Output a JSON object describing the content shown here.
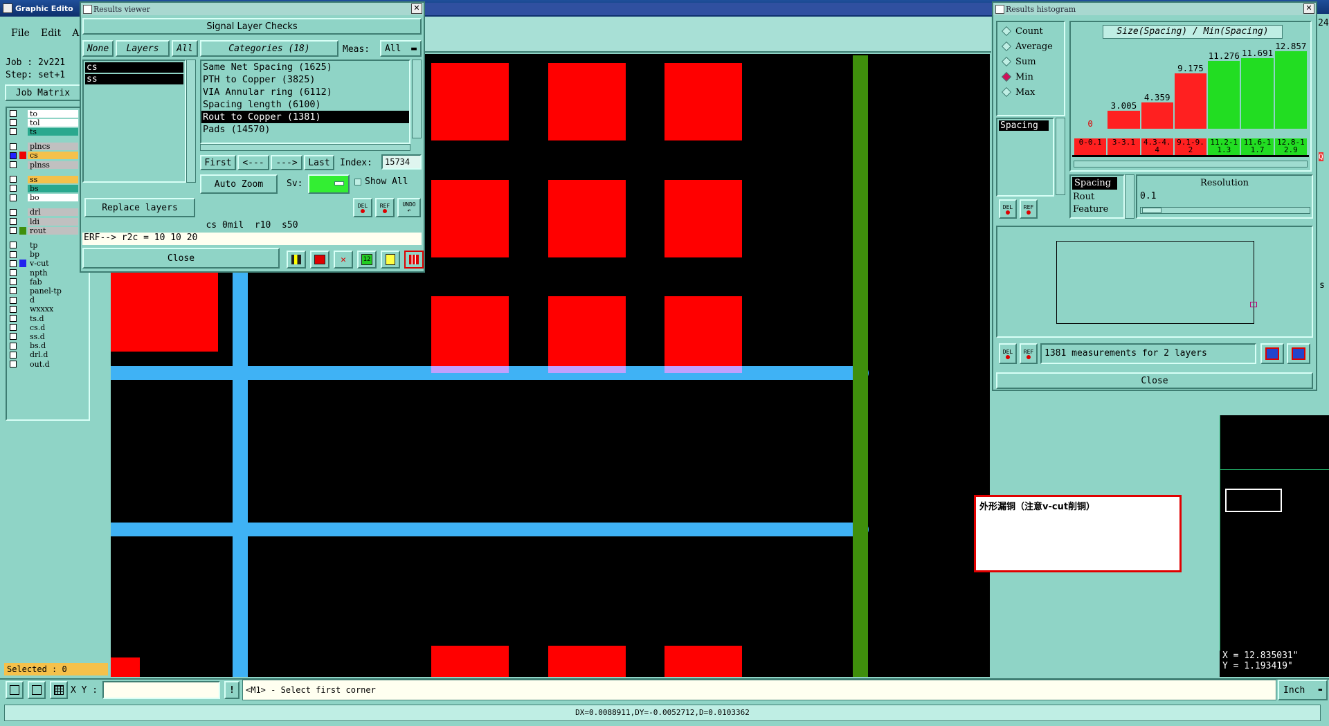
{
  "main_window": {
    "title": "Graphic Edito",
    "menu": [
      "File",
      "Edit",
      "A"
    ],
    "job_label": "Job : 2v221",
    "step_label": "Step: set+1",
    "job_matrix_label": "Job Matrix",
    "selected_label": "Selected : 0"
  },
  "layers": [
    {
      "name": "to",
      "color": "#ffffff"
    },
    {
      "name": "tol",
      "color": "#ffffff"
    },
    {
      "name": "ts",
      "color": "#2aa88e"
    },
    {
      "name": "plncs",
      "color": "#c0c0c0"
    },
    {
      "name": "cs",
      "color": "#f5c14b",
      "active": true
    },
    {
      "name": "plnss",
      "color": "#c0c0c0"
    },
    {
      "name": "ss",
      "color": "#f5c14b"
    },
    {
      "name": "bs",
      "color": "#2aa88e"
    },
    {
      "name": "bo",
      "color": "#ffffff"
    },
    {
      "name": "drl",
      "color": "#c0c0c0"
    },
    {
      "name": "ldi",
      "color": "#c0c0c0"
    },
    {
      "name": "rout",
      "color": "#c0c0c0"
    },
    {
      "name": "tp",
      "color": "#8fd4c6"
    },
    {
      "name": "bp",
      "color": "#8fd4c6"
    },
    {
      "name": "v-cut",
      "color": "#8fd4c6"
    },
    {
      "name": "npth",
      "color": "#8fd4c6"
    },
    {
      "name": "fab",
      "color": "#8fd4c6"
    },
    {
      "name": "panel-tp",
      "color": "#8fd4c6"
    },
    {
      "name": "d",
      "color": "#8fd4c6"
    },
    {
      "name": "wxxxx",
      "color": "#8fd4c6"
    },
    {
      "name": "ts.d",
      "color": "#8fd4c6"
    },
    {
      "name": "cs.d",
      "color": "#8fd4c6"
    },
    {
      "name": "ss.d",
      "color": "#8fd4c6"
    },
    {
      "name": "bs.d",
      "color": "#8fd4c6"
    },
    {
      "name": "drl.d",
      "color": "#8fd4c6"
    },
    {
      "name": "out.d",
      "color": "#8fd4c6"
    }
  ],
  "results_viewer": {
    "title": "Results viewer",
    "header": "Signal Layer Checks",
    "none_label": "None",
    "layers_label": "Layers",
    "all_label": "All",
    "categories_label": "Categories (18)",
    "meas_label": "Meas:",
    "meas_value": "All",
    "layer_list": [
      "cs",
      "ss"
    ],
    "categories": [
      {
        "text": "Same Net Spacing (1625)"
      },
      {
        "text": "PTH to Copper (3825)"
      },
      {
        "text": "VIA Annular ring (6112)"
      },
      {
        "text": "Spacing length (6100)"
      },
      {
        "text": "Rout to Copper (1381)",
        "selected": true
      },
      {
        "text": "Pads (14570)"
      }
    ],
    "first_label": "First",
    "prev_label": "<---",
    "next_label": "--->",
    "last_label": "Last",
    "index_label": "Index:",
    "index_value": "15734",
    "auto_zoom_label": "Auto Zoom",
    "sv_label": "Sv:",
    "show_all_label": "Show All",
    "replace_layers_label": "Replace layers",
    "del_label": "DEL",
    "ref_label": "REF",
    "undo_label": "UNDO",
    "info_line": "cs 0mil  r10  s50",
    "erf_line": "ERF--> r2c = 10 10 20",
    "close_label": "Close"
  },
  "histogram": {
    "title": "Results histogram",
    "radio_options": [
      {
        "label": "Count",
        "selected": false
      },
      {
        "label": "Average",
        "selected": false
      },
      {
        "label": "Sum",
        "selected": false
      },
      {
        "label": "Min",
        "selected": true
      },
      {
        "label": "Max",
        "selected": false
      }
    ],
    "list_item": "Spacing",
    "chart_title": "Size(Spacing) / Min(Spacing)",
    "bins": [
      {
        "range": "0-0.1",
        "value": 0,
        "label": "0",
        "color": "#ff2020"
      },
      {
        "range": "3-3.1",
        "value": 3.005,
        "label": "3.005",
        "color": "#ff2020"
      },
      {
        "range": "4.3-4.4",
        "value": 4.359,
        "label": "4.359",
        "color": "#ff2020"
      },
      {
        "range": "9.1-9.2",
        "value": 9.175,
        "label": "9.175",
        "color": "#ff2020"
      },
      {
        "range": "11.2-11.3",
        "value": 11.276,
        "label": "11.276",
        "color": "#22dd22"
      },
      {
        "range": "11.6-11.7",
        "value": 11.691,
        "label": "11.691",
        "color": "#22dd22"
      },
      {
        "range": "12.8-12.9",
        "value": 12.857,
        "label": "12.857",
        "color": "#22dd22"
      }
    ],
    "attr_list": [
      "Spacing",
      "Rout",
      "Feature"
    ],
    "resolution_label": "Resolution",
    "resolution_value": "0.1",
    "status": "1381 measurements for 2 layers",
    "del_label": "DEL",
    "ref_label": "REF",
    "close_label": "Close"
  },
  "canvas": {
    "annotation": "外形漏铜（注意v-cut削铜）",
    "x_coord": "X = 12.835031\"",
    "y_coord": "Y = 1.193419\""
  },
  "bottom_bar": {
    "xy_label": "X Y :",
    "xy_value": "",
    "prompt": "<M1> - Select first corner",
    "units": "Inch",
    "measure": "DX=0.0088911,DY=-0.0052712,D=0.0103362"
  },
  "right_edge_fragments": [
    "24",
    "s",
    "Q"
  ]
}
